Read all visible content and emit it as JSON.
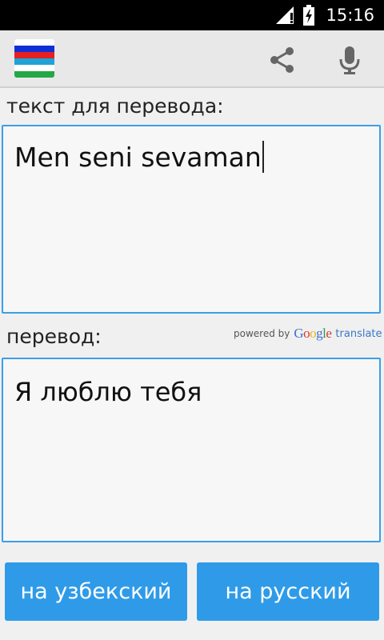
{
  "status": {
    "time": "15:16"
  },
  "actionbar": {
    "flag_colors": [
      "#0f2fd6",
      "#e62020",
      "#1fa2d6",
      "#ffffff",
      "#22a846"
    ],
    "share_icon": "share-icon",
    "mic_icon": "microphone-icon"
  },
  "source": {
    "label": "текст для перевода:",
    "text": "Men seni sevaman"
  },
  "result": {
    "label": "перевод:",
    "text": "Я люблю тебя",
    "powered_by": "powered by",
    "google": "Google",
    "translate_word": "translate"
  },
  "buttons": {
    "to_uzbek": "на узбекский",
    "to_russian": "на русский"
  },
  "colors": {
    "accent": "#2f9be8",
    "border": "#3b9ee8"
  }
}
